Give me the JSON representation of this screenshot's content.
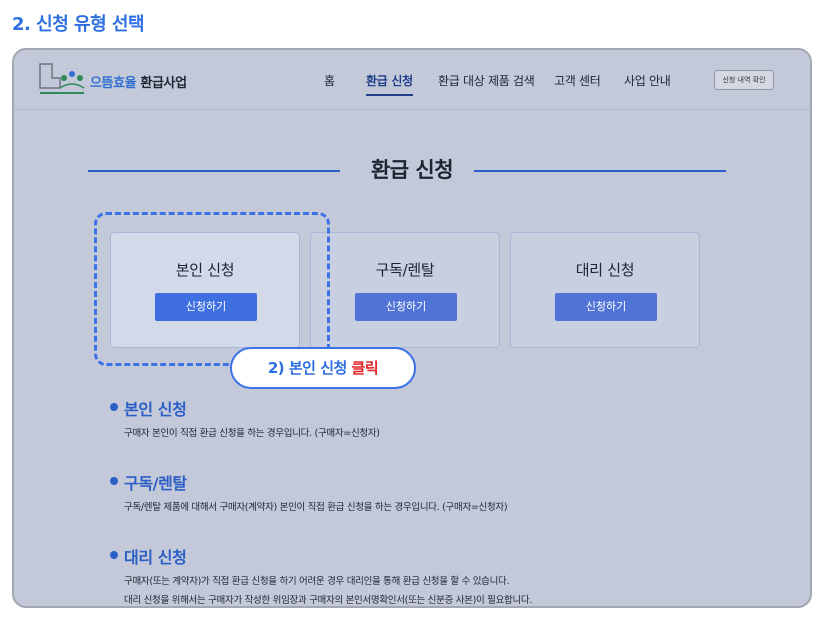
{
  "step_title": "2. 신청 유형 선택",
  "header": {
    "brand_part1": "으뜸효율",
    "brand_part2": "환급사업",
    "nav": [
      "홈",
      "환급 신청",
      "환급 대상 제품 검색",
      "고객 센터",
      "사업 안내"
    ],
    "active_nav": "환급 신청",
    "check_button": "신청 내역 확인"
  },
  "main": {
    "title": "환급 신청",
    "cards": [
      {
        "title": "본인 신청",
        "button": "신청하기",
        "selected": true
      },
      {
        "title": "구독/렌탈",
        "button": "신청하기",
        "selected": false
      },
      {
        "title": "대리 신청",
        "button": "신청하기",
        "selected": false
      }
    ],
    "callout_prefix": "2) 본인 신청 ",
    "callout_action": "클릭",
    "descriptions": [
      {
        "title": "본인 신청",
        "lines": [
          "구매자 본인이 직접 환급 신청을 하는 경우입니다. (구매자=신청자)"
        ]
      },
      {
        "title": "구독/렌탈",
        "lines": [
          "구독/렌탈 제품에 대해서 구매자(계약자) 본인이 직접 환급 신청을 하는 경우입니다. (구매자=신청자)"
        ]
      },
      {
        "title": "대리 신청",
        "lines": [
          "구매자(또는 계약자)가 직접 환급 신청을 하기 어려운 경우 대리인을 통해 환급 신청을 할 수 있습니다.",
          "대리 신청을 위해서는 구매자가 작성한 위임장과 구매자의 본인서명확인서(또는 신분증 사본)이 필요합니다."
        ]
      }
    ]
  },
  "colors": {
    "accent": "#2d6ee0",
    "button": "#3f6fe0",
    "highlight_text": "#e3242b",
    "background": "#c3c9d9"
  }
}
